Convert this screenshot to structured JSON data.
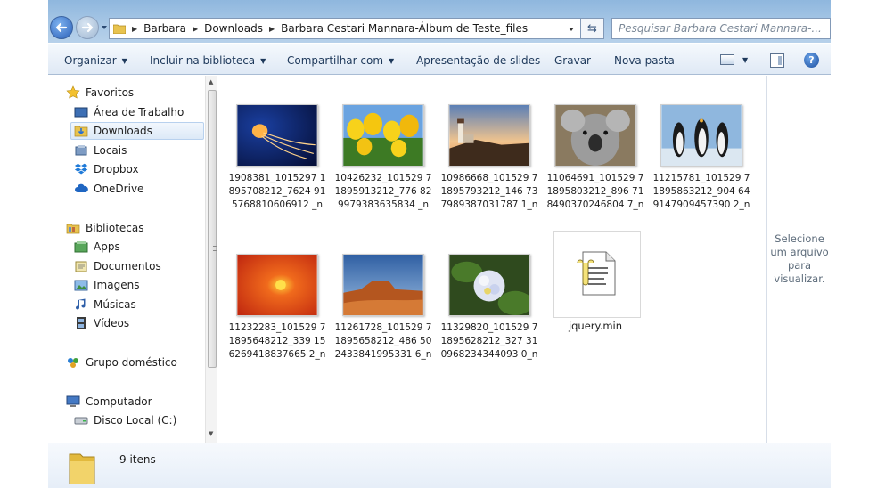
{
  "address": {
    "crumbs": [
      "Barbara",
      "Downloads",
      "Barbara Cestari Mannara-Álbum de Teste_files"
    ]
  },
  "search": {
    "placeholder": "Pesquisar Barbara Cestari Mannara-..."
  },
  "toolbar": {
    "organize": "Organizar",
    "include": "Incluir na biblioteca",
    "share": "Compartilhar com",
    "slideshow": "Apresentação de slides",
    "burn": "Gravar",
    "new_folder": "Nova pasta",
    "help": "?"
  },
  "nav": {
    "favorites": "Favoritos",
    "desktop": "Área de Trabalho",
    "downloads": "Downloads",
    "places": "Locais",
    "dropbox": "Dropbox",
    "onedrive": "OneDrive",
    "libraries": "Bibliotecas",
    "apps": "Apps",
    "documents": "Documentos",
    "images": "Imagens",
    "music": "Músicas",
    "videos": "Vídeos",
    "homegroup": "Grupo doméstico",
    "computer": "Computador",
    "local_disk": "Disco Local (C:)"
  },
  "files": [
    {
      "name": "1908381_1015297 1895708212_7624 915768810606912 _n",
      "thumb": "jellyfish"
    },
    {
      "name": "10426232_101529 71895913212_776 829979383635834 _n",
      "thumb": "tulips"
    },
    {
      "name": "10986668_101529 71895793212_146 737989387031787 1_n",
      "thumb": "lighthouse"
    },
    {
      "name": "11064691_101529 71895803212_896 718490370246804 7_n",
      "thumb": "koala"
    },
    {
      "name": "11215781_101529 71895863212_904 649147909457390 2_n",
      "thumb": "penguins"
    },
    {
      "name": "11232283_101529 71895648212_339 156269418837665 2_n",
      "thumb": "chrysanthemum"
    },
    {
      "name": "11261728_101529 71895658212_486 502433841995331 6_n",
      "thumb": "desert"
    },
    {
      "name": "11329820_101529 71895628212_327 310968234344093 0_n",
      "thumb": "hydrangeas"
    },
    {
      "name": "jquery.min",
      "thumb": "script-file-icon"
    }
  ],
  "preview": {
    "text": "Selecione um arquivo para visualizar."
  },
  "status": {
    "count": "9 itens"
  }
}
